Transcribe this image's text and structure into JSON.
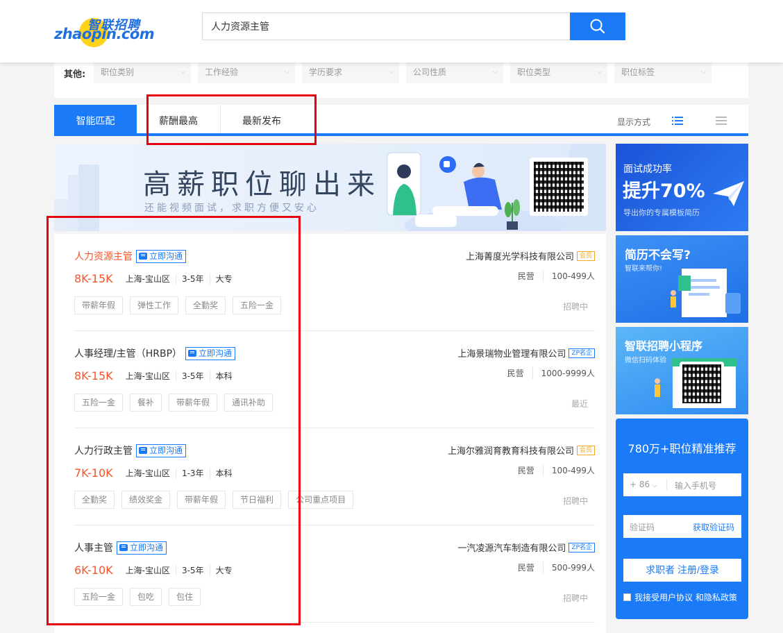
{
  "logo": {
    "cn": "智联招聘",
    "en": "zhaopin.com"
  },
  "search": {
    "value": "人力资源主管"
  },
  "filters": {
    "label": "其他:",
    "items": [
      "职位类别",
      "工作经验",
      "学历要求",
      "公司性质",
      "职位类型",
      "职位标签"
    ]
  },
  "tabs": [
    "智能匹配",
    "薪酬最高",
    "最新发布"
  ],
  "display_label": "显示方式",
  "banner": {
    "title": "高薪职位聊出来",
    "subtitle": "还能视频面试，求职方便又安心"
  },
  "jobs": [
    {
      "title": "人力资源主管",
      "chat": "立即沟通",
      "salary": "8K-15K",
      "location": "上海-宝山区",
      "experience": "3-5年",
      "education": "大专",
      "tags": [
        "带薪年假",
        "弹性工作",
        "全勤奖",
        "五险一金"
      ],
      "company": "上海菁度光学科技有限公司",
      "badge": "会员",
      "company_type": "民营",
      "company_size": "100-499人",
      "status": "招聘中"
    },
    {
      "title": "人事经理/主管（HRBP）",
      "chat": "立即沟通",
      "salary": "8K-15K",
      "location": "上海-宝山区",
      "experience": "3-5年",
      "education": "本科",
      "tags": [
        "五险一金",
        "餐补",
        "带薪年假",
        "通讯补助"
      ],
      "company": "上海景瑞物业管理有限公司",
      "badge": "ZP名企",
      "company_type": "民营",
      "company_size": "1000-9999人",
      "status": "最近"
    },
    {
      "title": "人力行政主管",
      "chat": "立即沟通",
      "salary": "7K-10K",
      "location": "上海-宝山区",
      "experience": "1-3年",
      "education": "本科",
      "tags": [
        "全勤奖",
        "绩效奖金",
        "带薪年假",
        "节日福利",
        "公司重点项目"
      ],
      "company": "上海尔雅润育教育科技有限公司",
      "badge": "会员",
      "company_type": "民营",
      "company_size": "100-499人",
      "status": "招聘中"
    },
    {
      "title": "人事主管",
      "chat": "立即沟通",
      "salary": "6K-10K",
      "location": "上海-宝山区",
      "experience": "3-5年",
      "education": "大专",
      "tags": [
        "五险一金",
        "包吃",
        "包住"
      ],
      "company": "一汽凌源汽车制造有限公司",
      "badge": "ZP名企",
      "company_type": "民营",
      "company_size": "500-999人",
      "status": "招聘中"
    }
  ],
  "side_banners": {
    "b1": {
      "line1": "面试成功率",
      "line2": "提升70%",
      "line3": "导出你的专属模板简历"
    },
    "b2": {
      "line1": "简历不会写?",
      "line2": "智联来帮你!"
    },
    "b3": {
      "line1": "智联招聘小程序",
      "line2": "微信扫码体验"
    }
  },
  "register": {
    "title": "780万+职位精准推荐",
    "country_code": "+ 86",
    "phone_placeholder": "输入手机号",
    "code_placeholder": "验证码",
    "get_code": "获取验证码",
    "button": "求职者 注册/登录",
    "agree": "我接受用户协议 和隐私政策"
  },
  "colors": {
    "accent": "#1a7af8",
    "salary": "#f5542a",
    "annotation": "#e60012"
  }
}
